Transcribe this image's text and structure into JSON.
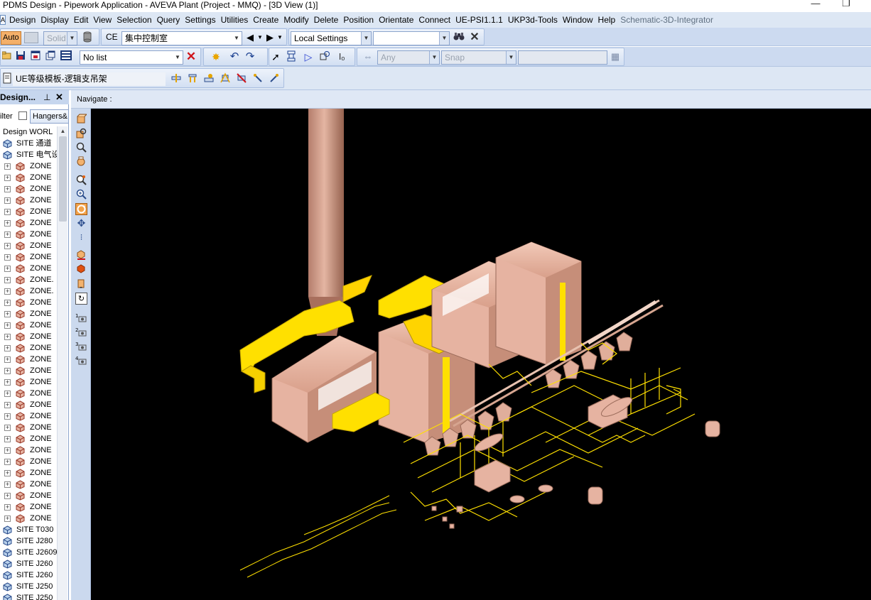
{
  "window": {
    "title": "PDMS Design - Pipework Application -  AVEVA Plant (Project - MMQ) - [3D View (1)]",
    "minimize_glyph": "—",
    "restore_glyph": "❐"
  },
  "menu": {
    "app_icon": "A",
    "items": [
      "Design",
      "Display",
      "Edit",
      "View",
      "Selection",
      "Query",
      "Settings",
      "Utilities",
      "Create",
      "Modify",
      "Delete",
      "Position",
      "Orientate",
      "Connect",
      "UE-PSI1.1.1",
      "UKP3d-Tools",
      "Window",
      "Help",
      "Schematic-3D-Integrator"
    ]
  },
  "toolbar1": {
    "auto_label": "Auto",
    "solid_label": "Solid",
    "ce_label": "CE",
    "ce_value": "集中控制室",
    "settings_value": "Local Settings",
    "search_value": ""
  },
  "toolbar2": {
    "list_value": "No list",
    "any_value": "Any",
    "snap_value": "Snap"
  },
  "toolbar3": {
    "template_value": "UE等级模板-逻辑支吊架"
  },
  "left_panel": {
    "title": "Design...",
    "pin_glyph": "⊥",
    "close_glyph": "✕",
    "filter_label": "ilter",
    "filter_button": "Hangers&",
    "tree": [
      {
        "label": "Design WORL",
        "expander": "",
        "icon": "none"
      },
      {
        "label": "SITE 通道",
        "expander": "",
        "icon": "site"
      },
      {
        "label": "SITE 电气设",
        "expander": "",
        "icon": "site"
      },
      {
        "label": "ZONE",
        "expander": "+",
        "icon": "zone"
      },
      {
        "label": "ZONE",
        "expander": "+",
        "icon": "zone"
      },
      {
        "label": "ZONE",
        "expander": "+",
        "icon": "zone"
      },
      {
        "label": "ZONE",
        "expander": "+",
        "icon": "zone"
      },
      {
        "label": "ZONE",
        "expander": "+",
        "icon": "zone"
      },
      {
        "label": "ZONE",
        "expander": "+",
        "icon": "zone"
      },
      {
        "label": "ZONE",
        "expander": "+",
        "icon": "zone"
      },
      {
        "label": "ZONE",
        "expander": "+",
        "icon": "zone"
      },
      {
        "label": "ZONE",
        "expander": "+",
        "icon": "zone"
      },
      {
        "label": "ZONE",
        "expander": "+",
        "icon": "zone"
      },
      {
        "label": "ZONE.",
        "expander": "+",
        "icon": "zone"
      },
      {
        "label": "ZONE.",
        "expander": "+",
        "icon": "zone"
      },
      {
        "label": "ZONE",
        "expander": "+",
        "icon": "zone"
      },
      {
        "label": "ZONE",
        "expander": "+",
        "icon": "zone"
      },
      {
        "label": "ZONE",
        "expander": "+",
        "icon": "zone"
      },
      {
        "label": "ZONE",
        "expander": "+",
        "icon": "zone"
      },
      {
        "label": "ZONE",
        "expander": "+",
        "icon": "zone"
      },
      {
        "label": "ZONE",
        "expander": "+",
        "icon": "zone"
      },
      {
        "label": "ZONE",
        "expander": "+",
        "icon": "zone"
      },
      {
        "label": "ZONE",
        "expander": "+",
        "icon": "zone"
      },
      {
        "label": "ZONE",
        "expander": "+",
        "icon": "zone"
      },
      {
        "label": "ZONE",
        "expander": "+",
        "icon": "zone"
      },
      {
        "label": "ZONE",
        "expander": "+",
        "icon": "zone"
      },
      {
        "label": "ZONE",
        "expander": "+",
        "icon": "zone"
      },
      {
        "label": "ZONE",
        "expander": "+",
        "icon": "zone"
      },
      {
        "label": "ZONE",
        "expander": "+",
        "icon": "zone"
      },
      {
        "label": "ZONE",
        "expander": "+",
        "icon": "zone"
      },
      {
        "label": "ZONE",
        "expander": "+",
        "icon": "zone"
      },
      {
        "label": "ZONE",
        "expander": "+",
        "icon": "zone"
      },
      {
        "label": "ZONE",
        "expander": "+",
        "icon": "zone"
      },
      {
        "label": "ZONE",
        "expander": "+",
        "icon": "zone"
      },
      {
        "label": "ZONE",
        "expander": "+",
        "icon": "zone"
      },
      {
        "label": "SITE T030",
        "expander": "",
        "icon": "site"
      },
      {
        "label": "SITE J280",
        "expander": "",
        "icon": "site"
      },
      {
        "label": "SITE J2609",
        "expander": "",
        "icon": "site"
      },
      {
        "label": "SITE J260",
        "expander": "",
        "icon": "site"
      },
      {
        "label": "SITE J260",
        "expander": "",
        "icon": "site"
      },
      {
        "label": "SITE J250",
        "expander": "",
        "icon": "site"
      },
      {
        "label": "SITE J250",
        "expander": "",
        "icon": "site"
      }
    ]
  },
  "navigate": {
    "label": "Navigate :"
  },
  "side_tools": {
    "camera_numbers": [
      "1",
      "2",
      "3",
      "4"
    ]
  },
  "colors": {
    "menubar_bg": "#dde7f4",
    "toolbar_bg": "#ccdaf0",
    "viewport_bg": "#000000",
    "equipment_pink": "#e6b3a1",
    "duct_yellow": "#ffe000"
  }
}
